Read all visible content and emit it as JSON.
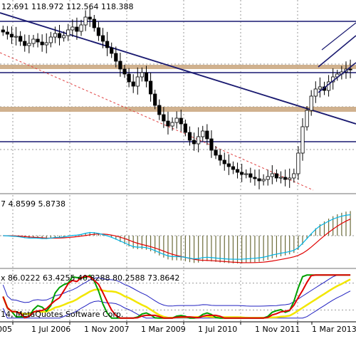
{
  "colors": {
    "bg": "#ffffff",
    "grid": "#9a9a9a",
    "sep": "#707070",
    "frame": "#000000",
    "candle": "#000000",
    "trend": "#191970",
    "zone": "#c8a37a",
    "dashed_trend": "#e04040",
    "macd_signal": "#e00000",
    "macd_histogram": "#6b6b3a",
    "macd_main": "#00b4e6",
    "stoch_red": "#e00000",
    "stoch_green": "#00a000",
    "stoch_yellow": "#f2e600",
    "stoch_blue": "#2020c0"
  },
  "header": {
    "ohlc_text": "12.691 118.972 112.564 118.388"
  },
  "macd_panel": {
    "values_text": "7 4.8599 5.8738"
  },
  "stoch_panel": {
    "values_text": "x 86.0222 63.4255 40.8288 80.2588 73.8642",
    "copyright_text": "14, MetaQuotes Software Corp."
  },
  "x_axis": {
    "labels": [
      "005",
      "1 Jul 2006",
      "1 Nov 2007",
      "1 Mar 2009",
      "1 Jul 2010",
      "1 Nov 2011",
      "1 Mar 2013"
    ]
  },
  "chart_data": {
    "type": "candlestick",
    "title": "",
    "xlabel": "",
    "ylabel": "",
    "price_panel": {
      "header_values": [
        112.691,
        118.972,
        112.564,
        118.388
      ],
      "close_series_approx": [
        116.5,
        116.2,
        115.8,
        115.9,
        115.2,
        114.6,
        114.9,
        115.5,
        115.1,
        114.7,
        115.0,
        115.8,
        116.3,
        115.7,
        116.0,
        116.8,
        117.2,
        116.6,
        117.5,
        118.6,
        118.3,
        117.1,
        116.0,
        115.2,
        114.3,
        113.5,
        112.4,
        111.3,
        110.6,
        109.5,
        108.9,
        110.2,
        110.8,
        109.6,
        107.8,
        106.2,
        104.9,
        104.0,
        103.3,
        103.8,
        104.4,
        103.6,
        102.4,
        101.3,
        100.8,
        101.8,
        102.6,
        101.5,
        99.9,
        99.2,
        98.5,
        98.0,
        97.6,
        97.2,
        96.8,
        96.5,
        96.6,
        96.1,
        95.9,
        95.6,
        95.8,
        96.2,
        96.6,
        96.0,
        96.1,
        95.8,
        96.0,
        96.6,
        99.5,
        103.2,
        105.5,
        107.5,
        108.5,
        108.8,
        108.3,
        109.5,
        110.2,
        110.6,
        110.9,
        111.3,
        111.2
      ],
      "horizontal_levels": [
        118.0,
        110.8,
        101.1
      ],
      "resistance_zones": [
        [
          111.9,
          111.3
        ],
        [
          106.0,
          105.3
        ]
      ]
    },
    "macd_panel": {
      "label": "7 4.8599 5.8738",
      "values": [
        4.8599,
        5.8738
      ]
    },
    "stoch_panel": {
      "label": "x 86.0222 63.4255 40.8288 80.2588 73.8642",
      "values": [
        86.0222,
        63.4255,
        40.8288,
        80.2588,
        73.8642
      ]
    },
    "x_tick_labels": [
      "005",
      "1 Jul 2006",
      "1 Nov 2007",
      "1 Mar 2009",
      "1 Jul 2010",
      "1 Nov 2011",
      "1 Mar 2013"
    ]
  }
}
